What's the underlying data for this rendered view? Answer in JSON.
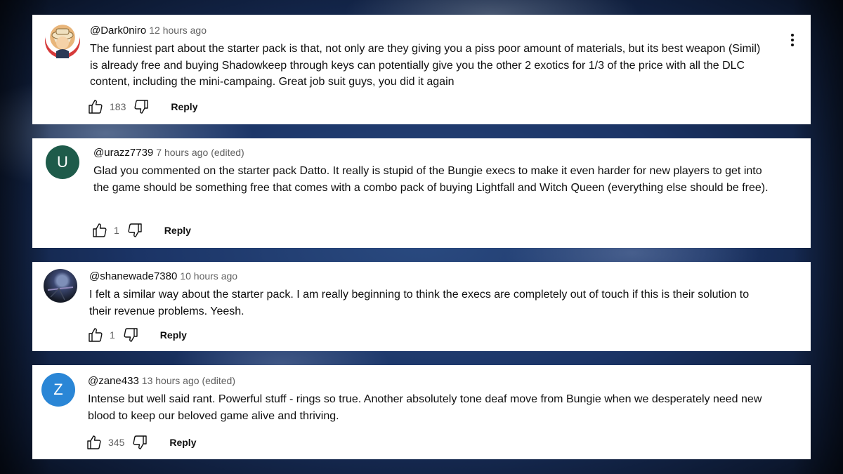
{
  "comments": [
    {
      "author": "@Dark0niro",
      "time": "12 hours ago",
      "edited": "",
      "avatar": {
        "type": "image",
        "icon": "cartoon-character-avatar",
        "letter": "",
        "color": "#d9d9d9"
      },
      "text": "The funniest part about the starter pack is that, not only are they giving you a piss poor amount of materials, but its best weapon (Simil) is already free and buying Shadowkeep through keys can potentially give you the other 2 exotics for 1/3 of the price with all the DLC content, including the mini-campaing. Great job suit guys, you did it again",
      "likes": "183",
      "reply_label": "Reply",
      "has_menu": true
    },
    {
      "author": "@urazz7739",
      "time": "7 hours ago",
      "edited": "(edited)",
      "avatar": {
        "type": "letter",
        "icon": "letter-avatar",
        "letter": "U",
        "color": "#1e5b4a"
      },
      "text": "Glad you commented on the starter pack Datto.  It really is stupid of the Bungie execs to make it even harder for new players to get into the game should be something free that comes with a combo pack of buying Lightfall and Witch Queen (everything else should be free).",
      "likes": "1",
      "reply_label": "Reply",
      "has_menu": false
    },
    {
      "author": "@shanewade7380",
      "time": "10 hours ago",
      "edited": "",
      "avatar": {
        "type": "image",
        "icon": "photo-avatar",
        "letter": "",
        "color": "#1a1f2e"
      },
      "text": "I felt a similar way about the starter pack. I am really beginning to think the execs are completely out of touch if this is their solution to their revenue problems. Yeesh.",
      "likes": "1",
      "reply_label": "Reply",
      "has_menu": false
    },
    {
      "author": "@zane433",
      "time": "13 hours ago",
      "edited": "(edited)",
      "avatar": {
        "type": "letter",
        "icon": "letter-avatar",
        "letter": "Z",
        "color": "#2a86d6"
      },
      "text": "Intense but well said rant. Powerful stuff - rings so true. Another absolutely tone deaf move from Bungie when we desperately need new blood to keep our beloved game alive and thriving.",
      "likes": "345",
      "reply_label": "Reply",
      "has_menu": false
    }
  ]
}
